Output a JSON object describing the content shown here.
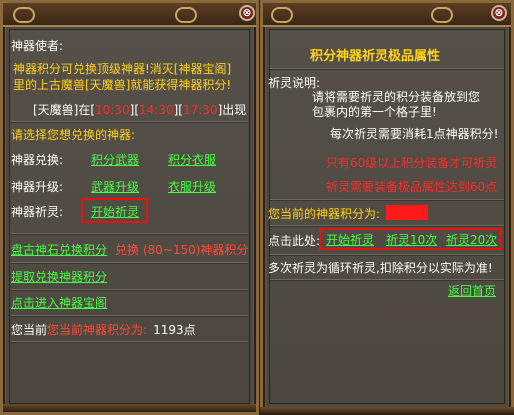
{
  "left_panel": {
    "close_symbol": "⊗",
    "envoy_title": "神器使者:",
    "intro_line1": "神器积分可兑换顶级神器!消灭[神器宝阁]",
    "intro_line2": "里的上古魔兽[天魔兽]就能获得神器积分!",
    "spawn": {
      "name": "[天魔兽]在[",
      "t1": "10:30",
      "sep1": "][",
      "t2": "14:30",
      "sep2": "][",
      "t3": "17:30",
      "tail": "]出现"
    },
    "prompt": "请选择您想兑换的神器:",
    "rows": [
      {
        "label": "神器兑换:",
        "links": [
          "积分武器",
          "积分衣服"
        ]
      },
      {
        "label": "神器升级:",
        "links": [
          "武器升级",
          "衣服升级"
        ]
      },
      {
        "label": "神器祈灵:",
        "links": [
          "开始祈灵"
        ]
      }
    ],
    "exchange_link": "盘古神石兑换积分",
    "exchange_detail": "兑换 (80~150)神器积分",
    "withdraw_link": "提取兑换神器积分",
    "enter_link": "点击进入神器宝阁",
    "points_label": "您当前神器积分为:",
    "points_value": "1193点"
  },
  "right_panel": {
    "close_symbol": "⊗",
    "title": "积分神器祈灵极品属性",
    "desc_title": "祈灵说明:",
    "desc1a": "请将需要祈灵的积分装备放到您",
    "desc1b": "包裹内的第一个格子里!",
    "desc2": "每次祈灵需要消耗1点神器积分!",
    "warn1": "只有60级以上积分装备才可祈灵",
    "warn2": "祈灵需要装备极品属性达到60点",
    "points_label": "您当前的神器积分为:",
    "action_label": "点击此处:",
    "actions": [
      "开始祈灵",
      "祈灵10次",
      "祈灵20次"
    ],
    "note": "多次祈灵为循环祈灵,扣除积分以实际为准!",
    "back_link": "返回首页"
  },
  "colors": {
    "panel": "#4d4840",
    "link_green": "#44ff44",
    "highlight_red": "#e81010",
    "text_yellow": "#ffd21b"
  }
}
